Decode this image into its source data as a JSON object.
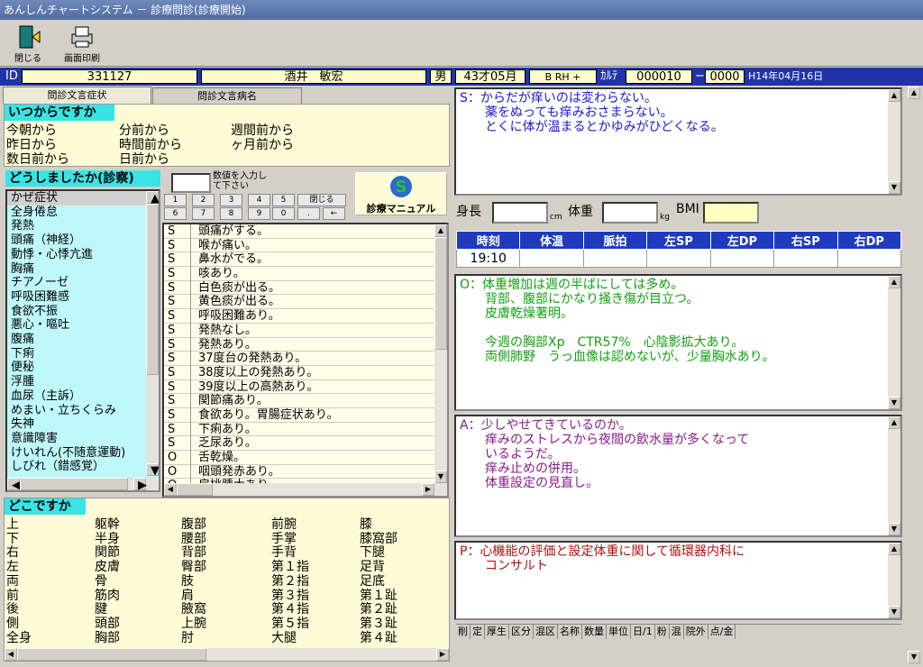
{
  "window": {
    "title": "あんしんチャートシステム － 診療問診(診療開始)"
  },
  "toolbar": {
    "close_label": "閉じる",
    "print_label": "画面印刷"
  },
  "patient": {
    "id_label": "ID",
    "id": "331127",
    "name": "酒井　敏宏",
    "sex": "男",
    "age": "43才05月",
    "blood": "B RH +",
    "karte_label": "ｶﾙﾃ",
    "karte_no": "000010",
    "karte_sub": "0000",
    "date": "H14年04月16日"
  },
  "tabs": [
    "問診文言症状",
    "問診文言病名"
  ],
  "when": {
    "header": "いつからですか",
    "options": [
      "今朝から",
      "分前から",
      "週間前から",
      "昨日から",
      "時間前から",
      "ヶ月前から",
      "数日前から",
      "日前から"
    ]
  },
  "complaint": {
    "header": "どうしましたか(診察)",
    "numeric_hint": "数値を入力して下さい",
    "keys": [
      "1",
      "2",
      "3",
      "4",
      "5",
      "閉じる",
      "6",
      "7",
      "8",
      "9",
      "0",
      ".",
      "←"
    ],
    "manual_label": "診療マニュアル",
    "symptoms": [
      "かぜ症状",
      "全身倦怠",
      "発熱",
      "頭痛（神経）",
      "動悸・心悸亢進",
      "胸痛",
      "チアノーゼ",
      "呼吸困難感",
      "食欲不振",
      "悪心・嘔吐",
      "腹痛",
      "下痢",
      "便秘",
      "浮腫",
      "血尿（主訴）",
      "めまい・立ちくらみ",
      "失神",
      "意識障害",
      "けいれん(不随意運動)",
      "しびれ（錯感覚）"
    ],
    "phrases": [
      [
        "S",
        "頭痛がする。"
      ],
      [
        "S",
        "喉が痛い。"
      ],
      [
        "S",
        "鼻水がでる。"
      ],
      [
        "S",
        "咳あり。"
      ],
      [
        "S",
        "白色痰が出る。"
      ],
      [
        "S",
        "黄色痰が出る。"
      ],
      [
        "S",
        "呼吸困難あり。"
      ],
      [
        "S",
        "発熱なし。"
      ],
      [
        "S",
        "発熱あり。"
      ],
      [
        "S",
        "37度台の発熱あり。"
      ],
      [
        "S",
        "38度以上の発熱あり。"
      ],
      [
        "S",
        "39度以上の高熱あり。"
      ],
      [
        "S",
        "関節痛あり。"
      ],
      [
        "S",
        "食欲あり。胃腸症状あり。"
      ],
      [
        "S",
        "下痢あり。"
      ],
      [
        "S",
        "乏尿あり。"
      ],
      [
        "O",
        "舌乾燥。"
      ],
      [
        "O",
        "咽頭発赤あり。"
      ],
      [
        "O",
        "扁桃腫大あり。"
      ]
    ]
  },
  "where": {
    "header": "どこですか",
    "parts": [
      [
        "上",
        "躯幹",
        "腹部",
        "前腕",
        "膝"
      ],
      [
        "下",
        "半身",
        "腰部",
        "手掌",
        "膝窩部"
      ],
      [
        "右",
        "関節",
        "背部",
        "手背",
        "下腿"
      ],
      [
        "左",
        "皮膚",
        "臀部",
        "第１指",
        "足背"
      ],
      [
        "両",
        "骨",
        "肢",
        "第２指",
        "足底"
      ],
      [
        "前",
        "筋肉",
        "肩",
        "第３指",
        "第１趾"
      ],
      [
        "後",
        "腱",
        "腋窩",
        "第４指",
        "第２趾"
      ],
      [
        "側",
        "頭部",
        "上腕",
        "第５指",
        "第３趾"
      ],
      [
        "全身",
        "胸部",
        "肘",
        "大腿",
        "第４趾"
      ]
    ]
  },
  "soap": {
    "s": [
      "S：からだが痒いのは変わらない。",
      "　　薬をぬっても痒みおさまらない。",
      "　　とくに体が温まるとかゆみがひどくなる。"
    ],
    "o": [
      "O：体重増加は週の半ばにしては多め。",
      "　　背部、腹部にかなり掻き傷が目立つ。",
      "　　皮膚乾燥著明。",
      "",
      "　　今週の胸部Xp　CTR57%　心陰影拡大あり。",
      "　　両側肺野　うっ血像は認めないが、少量胸水あり。"
    ],
    "a": [
      "A：少しやせてきているのか。",
      "　　痒みのストレスから夜間の飲水量が多くなって",
      "　　いるようだ。",
      "　　痒み止めの併用。",
      "　　体重設定の見直し。"
    ],
    "p": [
      "P：心機能の評価と設定体重に関して循環器内科に",
      "　　コンサルト"
    ]
  },
  "body": {
    "height_label": "身長",
    "height_unit": "cm",
    "weight_label": "体重",
    "weight_unit": "kg",
    "bmi_label": "BMI"
  },
  "vitals": {
    "headers": [
      "時刻",
      "体温",
      "脈拍",
      "左SP",
      "左DP",
      "右SP",
      "右DP"
    ],
    "row": [
      "19:10",
      "",
      "",
      "",
      "",
      "",
      ""
    ]
  },
  "orders": {
    "columns": [
      "削",
      "定",
      "厚生",
      "区分",
      "混区",
      "名称",
      "数量",
      "単位",
      "日/1",
      "粉",
      "混",
      "院外",
      "点/金"
    ]
  },
  "colors": {
    "s": "#1a1ad0",
    "o": "#12a012",
    "a": "#8a1a8a",
    "p": "#b01010"
  }
}
